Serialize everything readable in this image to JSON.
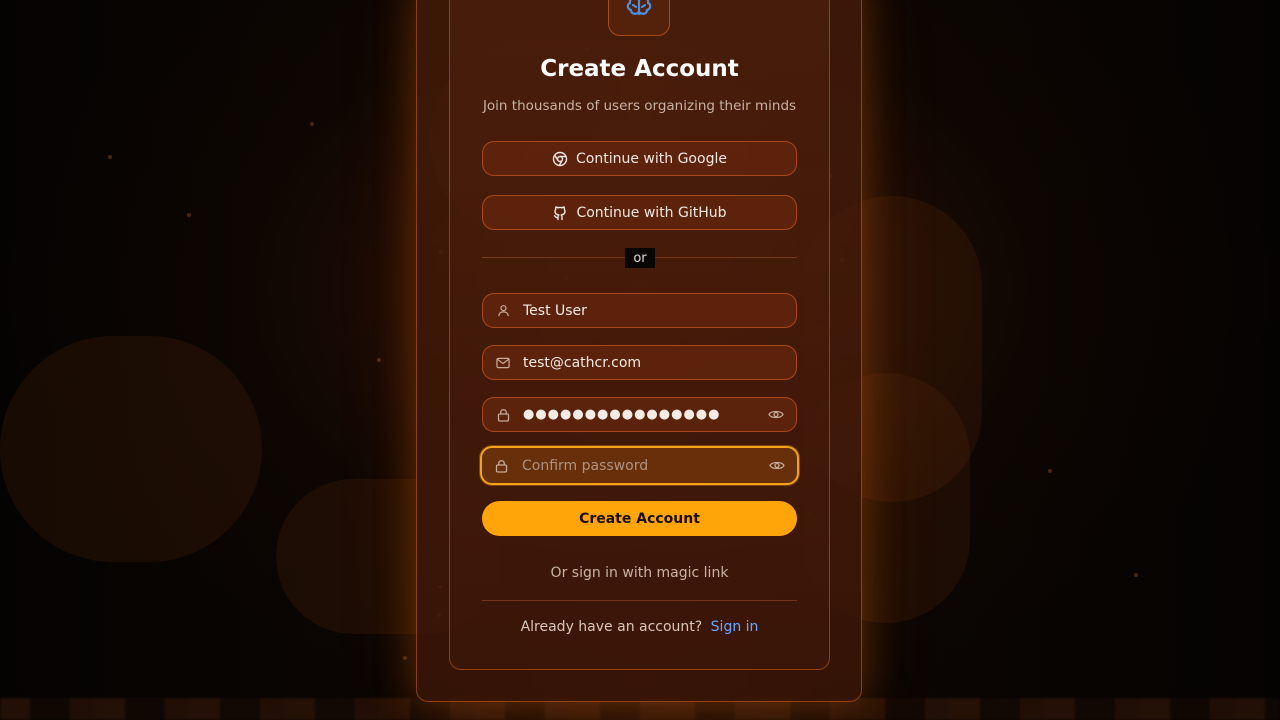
{
  "header": {
    "logo_icon": "brain-icon",
    "title": "Create Account",
    "subtitle": "Join thousands of users organizing their minds"
  },
  "oauth": {
    "google_label": "Continue with Google",
    "google_icon": "chrome-icon",
    "github_label": "Continue with GitHub",
    "github_icon": "github-icon"
  },
  "divider": {
    "text": "or"
  },
  "form": {
    "name": {
      "value": "Test User",
      "icon": "user-icon"
    },
    "email": {
      "value": "test@cathcr.com",
      "icon": "mail-icon"
    },
    "password": {
      "value": "●●●●●●●●●●●●●●●●",
      "icon": "lock-icon",
      "toggle_icon": "eye-icon"
    },
    "confirm": {
      "placeholder": "Confirm password",
      "value": "",
      "icon": "lock-icon",
      "toggle_icon": "eye-icon"
    },
    "submit_label": "Create Account"
  },
  "magic_link": {
    "label": "Or sign in with magic link"
  },
  "footer": {
    "prompt": "Already have an account?",
    "link": "Sign in"
  },
  "colors": {
    "accent": "#ffa509",
    "link": "#6aa7ff",
    "border": "#c85a23",
    "logo": "#4a90e2"
  }
}
